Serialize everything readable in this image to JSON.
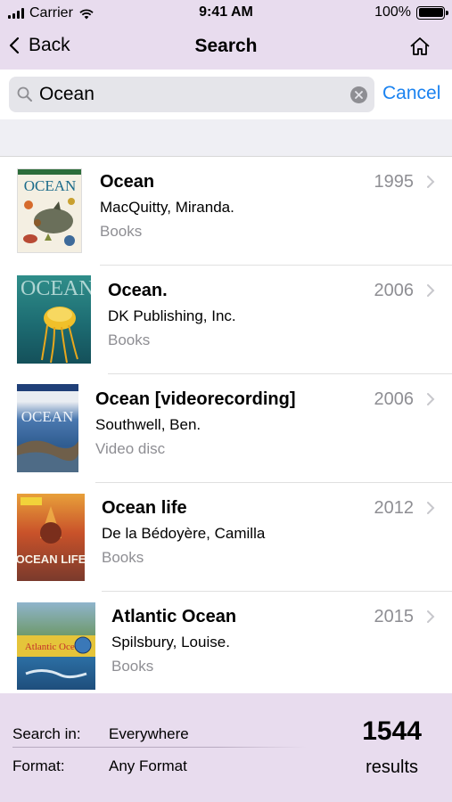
{
  "status_bar": {
    "carrier": "Carrier",
    "time": "9:41 AM",
    "battery": "100%",
    "icons": [
      "signal-bars-icon",
      "wifi-icon",
      "battery-icon"
    ]
  },
  "nav": {
    "back_label": "Back",
    "title": "Search",
    "home_icon": "home-icon"
  },
  "search": {
    "value": "Ocean",
    "placeholder": "",
    "cancel_label": "Cancel"
  },
  "results": [
    {
      "title": "Ocean",
      "author": "MacQuitty, Miranda.",
      "format": "Books",
      "year": "1995",
      "cover_text": "OCEAN"
    },
    {
      "title": "Ocean.",
      "author": "DK Publishing, Inc.",
      "format": "Books",
      "year": "2006",
      "cover_text": "OCEAN"
    },
    {
      "title": "Ocean [videorecording]",
      "author": "Southwell, Ben.",
      "format": "Video disc",
      "year": "2006",
      "cover_text": "OCEAN"
    },
    {
      "title": "Ocean life",
      "author": "De la Bédoyère, Camilla",
      "format": "Books",
      "year": "2012",
      "cover_text": "OCEAN LIFE"
    },
    {
      "title": "Atlantic Ocean",
      "author": "Spilsbury, Louise.",
      "format": "Books",
      "year": "2015",
      "cover_text": "Atlantic Ocean"
    }
  ],
  "footer": {
    "search_in_label": "Search in:",
    "search_in_value": "Everywhere",
    "format_label": "Format:",
    "format_value": "Any Format",
    "count": "1544",
    "count_label": "results"
  },
  "colors": {
    "bar_background": "#e8dcee",
    "accent": "#1a82f0",
    "secondary_text": "#8e8e93"
  }
}
